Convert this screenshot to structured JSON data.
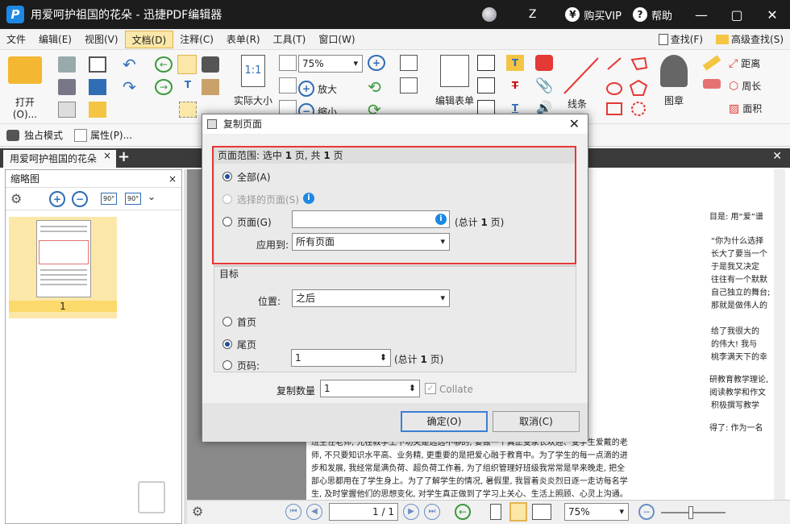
{
  "window": {
    "title": "用爱呵护祖国的花朵 - 迅捷PDF编辑器",
    "logo": "P",
    "z_label": "Z",
    "vip_label": "购买VIP",
    "help_label": "帮助",
    "vip_icon": "¥",
    "help_icon": "?"
  },
  "menu": {
    "items": [
      "文件",
      "编辑(E)",
      "视图(V)",
      "文档(D)",
      "注释(C)",
      "表单(R)",
      "工具(T)",
      "窗口(W)"
    ],
    "find": "查找(F)",
    "advanced_find": "高级查找(S)"
  },
  "ribbon": {
    "open": "打开(O)...",
    "actual_size": "实际大小",
    "zoom": "75%",
    "zoom_in": "放大",
    "zoom_out": "缩小",
    "edit_form": "编辑表单",
    "line": "线条",
    "stamp": "图章",
    "distance": "距离",
    "perimeter": "周长",
    "area": "面积",
    "one_to_one": "1:1"
  },
  "toolbar2": {
    "exclusive": "独占模式",
    "properties": "属性(P)..."
  },
  "tab": {
    "label": "用爱呵护祖国的花朵"
  },
  "thumbnails": {
    "title": "缩略图",
    "page_num": "1",
    "rot1": "90°",
    "rot2": "90°"
  },
  "dialog": {
    "title": "复制页面",
    "range_group": {
      "prefix": "页面范围: 选中 ",
      "sel": "1",
      "mid": " 页, 共 ",
      "total": "1",
      "suffix": " 页"
    },
    "opt_all": "全部(A)",
    "opt_selected": "选择的页面(S)",
    "opt_pages": "页面(G)",
    "pages_total_pre": "(总计 ",
    "pages_total_num": "1",
    "pages_total_post": " 页)",
    "apply_to_label": "应用到:",
    "apply_to_value": "所有页面",
    "target_title": "目标",
    "position_label": "位置:",
    "position_value": "之后",
    "opt_first": "首页",
    "opt_last": "尾页",
    "opt_pagenum": "页码:",
    "pagenum_value": "1",
    "pagenum_total_pre": "(总计 ",
    "pagenum_total_num": "1",
    "pagenum_total_post": " 页)",
    "copies_label": "复制数量",
    "copies_value": "1",
    "collate_label": "Collate",
    "ok": "确定(O)",
    "cancel": "取消(C)"
  },
  "document": {
    "lines": [
      "目是: 用“爱”谱",
      "“你为什么选择",
      "长大了要当一个",
      "于是我又决定",
      "往往有一个默默",
      "自己独立的舞台;",
      "那就是做伟人的",
      "给了我很大的",
      "的伟大! 我与",
      "桃李满天下的幸",
      "研教育教学理论,",
      "阅读教学和作文",
      "积极撰写教学",
      "得了: 作为一名",
      "班主任老师, 光在教学上下功夫是远远不够的, 要做一个真正受家长欢迎、受学生爱戴的老",
      "师, 不只要知识水平高、业务精, 更重要的是把爱心融于教育中。为了学生的每一点滴的进",
      "步和发展, 我经常是满负荷、超负荷工作着, 为了组织管理好班级我常常是早来晚走, 把全",
      "部心思都用在了学生身上。为了了解学生的情况, 暑假里, 我冒着炎炎烈日逐一走访每名学",
      "生, 及时掌握他们的思想变化, 对学生真正做到了学习上关心、生活上照顾、心灵上沟通。"
    ]
  },
  "statusbar": {
    "page_value": "1 / 1",
    "zoom": "75%"
  }
}
